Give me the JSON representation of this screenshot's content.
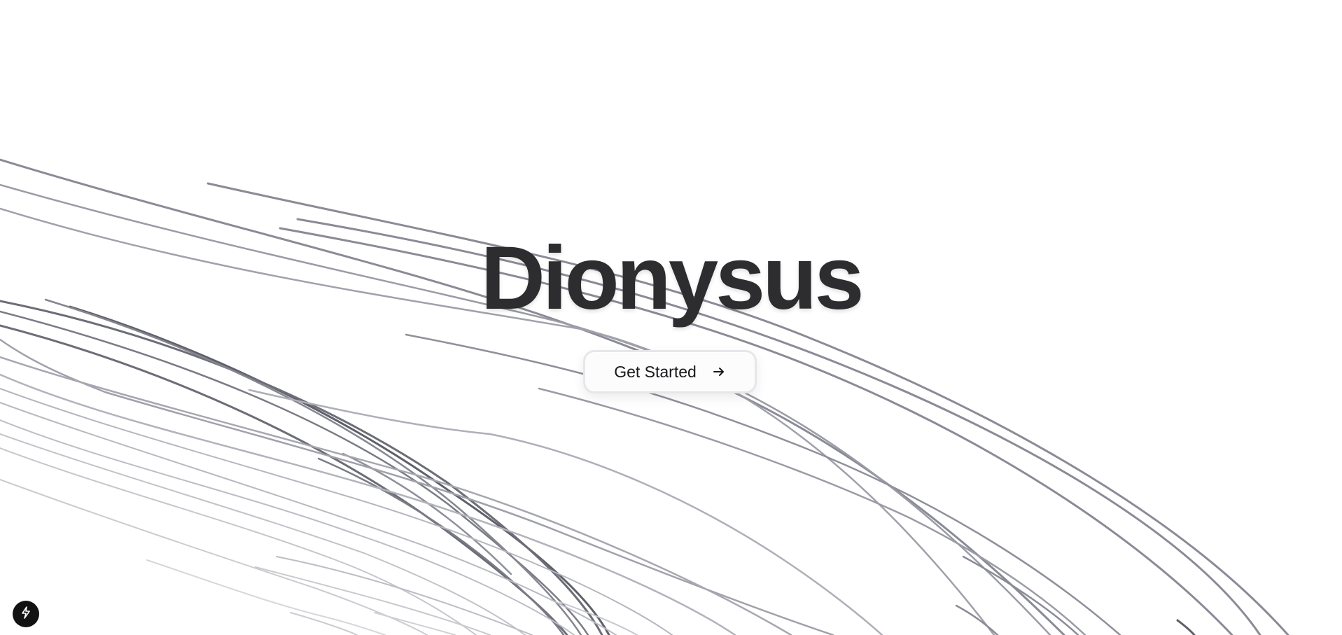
{
  "hero": {
    "title": "Dionysus"
  },
  "cta": {
    "label": "Get Started",
    "icon": "arrow-right-icon"
  },
  "badge": {
    "icon": "lightning-bolt-icon"
  },
  "colors": {
    "background": "#ffffff",
    "title": "#2d2d2f",
    "line_dark": "#5b5c66",
    "line_light": "#c9c9cf",
    "badge_bg": "#121212"
  }
}
